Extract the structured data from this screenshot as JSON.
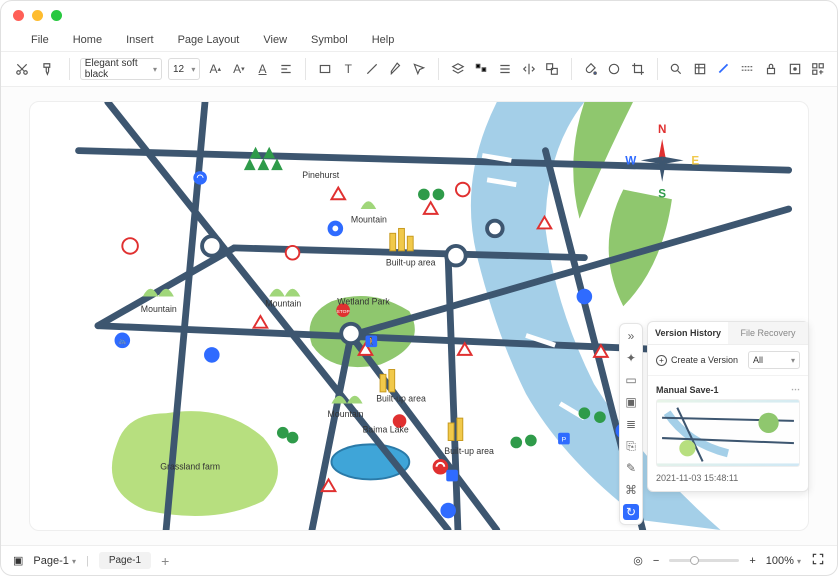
{
  "menu": {
    "file": "File",
    "home": "Home",
    "insert": "Insert",
    "page_layout": "Page Layout",
    "view": "View",
    "symbol": "Symbol",
    "help": "Help"
  },
  "toolbar": {
    "font": "Elegant soft black",
    "fontSize": "12"
  },
  "map": {
    "labels": {
      "pinehurst": "Pinehurst",
      "mountain": "Mountain",
      "wetland": "Wetland Park",
      "builtup": "Built-up area",
      "grassland": "Grassland farm",
      "baima": "Baima Lake"
    },
    "compass": {
      "n": "N",
      "e": "E",
      "s": "S",
      "w": "W"
    }
  },
  "panel": {
    "tabs": {
      "version": "Version History",
      "recovery": "File Recovery"
    },
    "create": "Create a Version",
    "filter": "All",
    "item": {
      "name": "Manual Save-1",
      "time": "2021-11-03 15:48:11"
    }
  },
  "status": {
    "page_selector": "Page-1",
    "page_tab": "Page-1",
    "zoom": "100%"
  }
}
